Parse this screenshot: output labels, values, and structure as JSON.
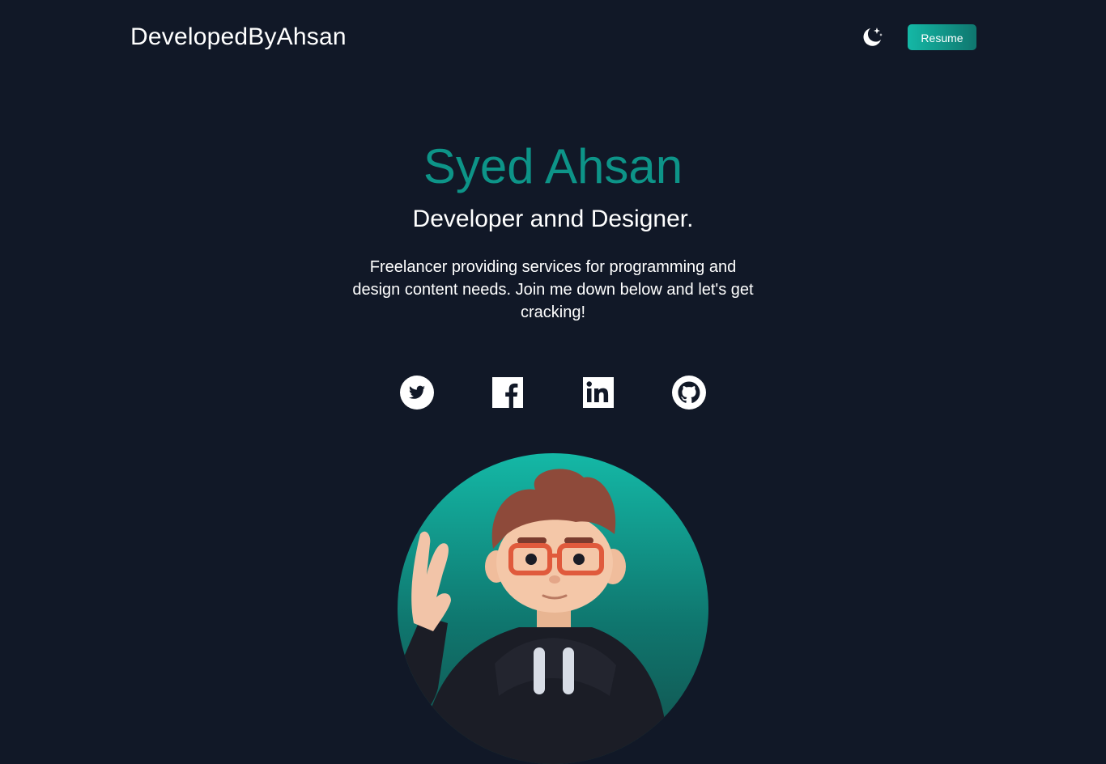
{
  "nav": {
    "brand": "DevelopedByAhsan",
    "theme_toggle_icon": "moon-stars-icon",
    "resume_label": "Resume"
  },
  "hero": {
    "name": "Syed Ahsan",
    "role": "Developer annd Designer.",
    "description": "Freelancer providing services for programming and design content needs. Join me down below and let's get cracking!"
  },
  "socials": [
    {
      "icon": "twitter-icon"
    },
    {
      "icon": "facebook-icon"
    },
    {
      "icon": "linkedin-icon"
    },
    {
      "icon": "github-icon"
    }
  ],
  "avatar": {
    "icon": "avatar-3d-character"
  },
  "colors": {
    "background": "#111827",
    "accent": "#0d9488",
    "accent_light": "#14b8a6",
    "text": "#ffffff"
  }
}
